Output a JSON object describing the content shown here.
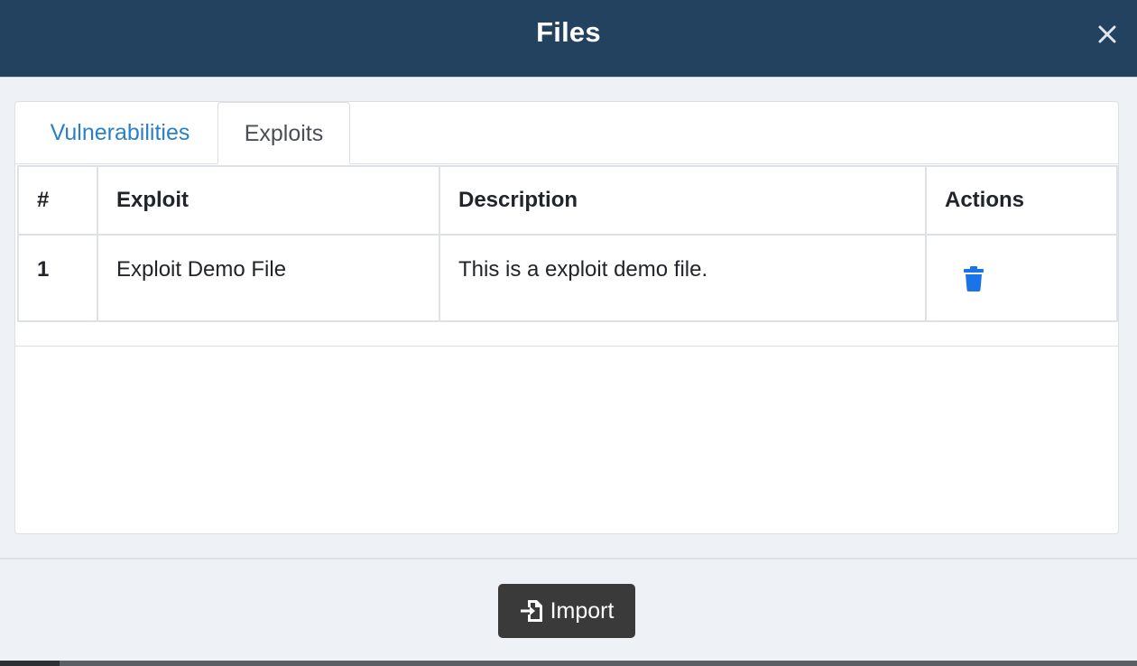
{
  "modal": {
    "title": "Files",
    "close_icon": "close-icon"
  },
  "tabs": [
    {
      "label": "Vulnerabilities",
      "active": false,
      "color": "#2a7fc9"
    },
    {
      "label": "Exploits",
      "active": true
    }
  ],
  "table": {
    "headers": [
      "#",
      "Exploit",
      "Description",
      "Actions"
    ],
    "rows": [
      {
        "num": "1",
        "exploit": "Exploit Demo File",
        "description": "This is a exploit demo file.",
        "action_icon": "trash-icon"
      }
    ]
  },
  "footer": {
    "import_label": "Import",
    "import_icon": "file-import-icon"
  },
  "colors": {
    "header_bg": "#23425f",
    "delete_icon": "#1a73e8",
    "import_button_bg": "#3a3a3a"
  }
}
